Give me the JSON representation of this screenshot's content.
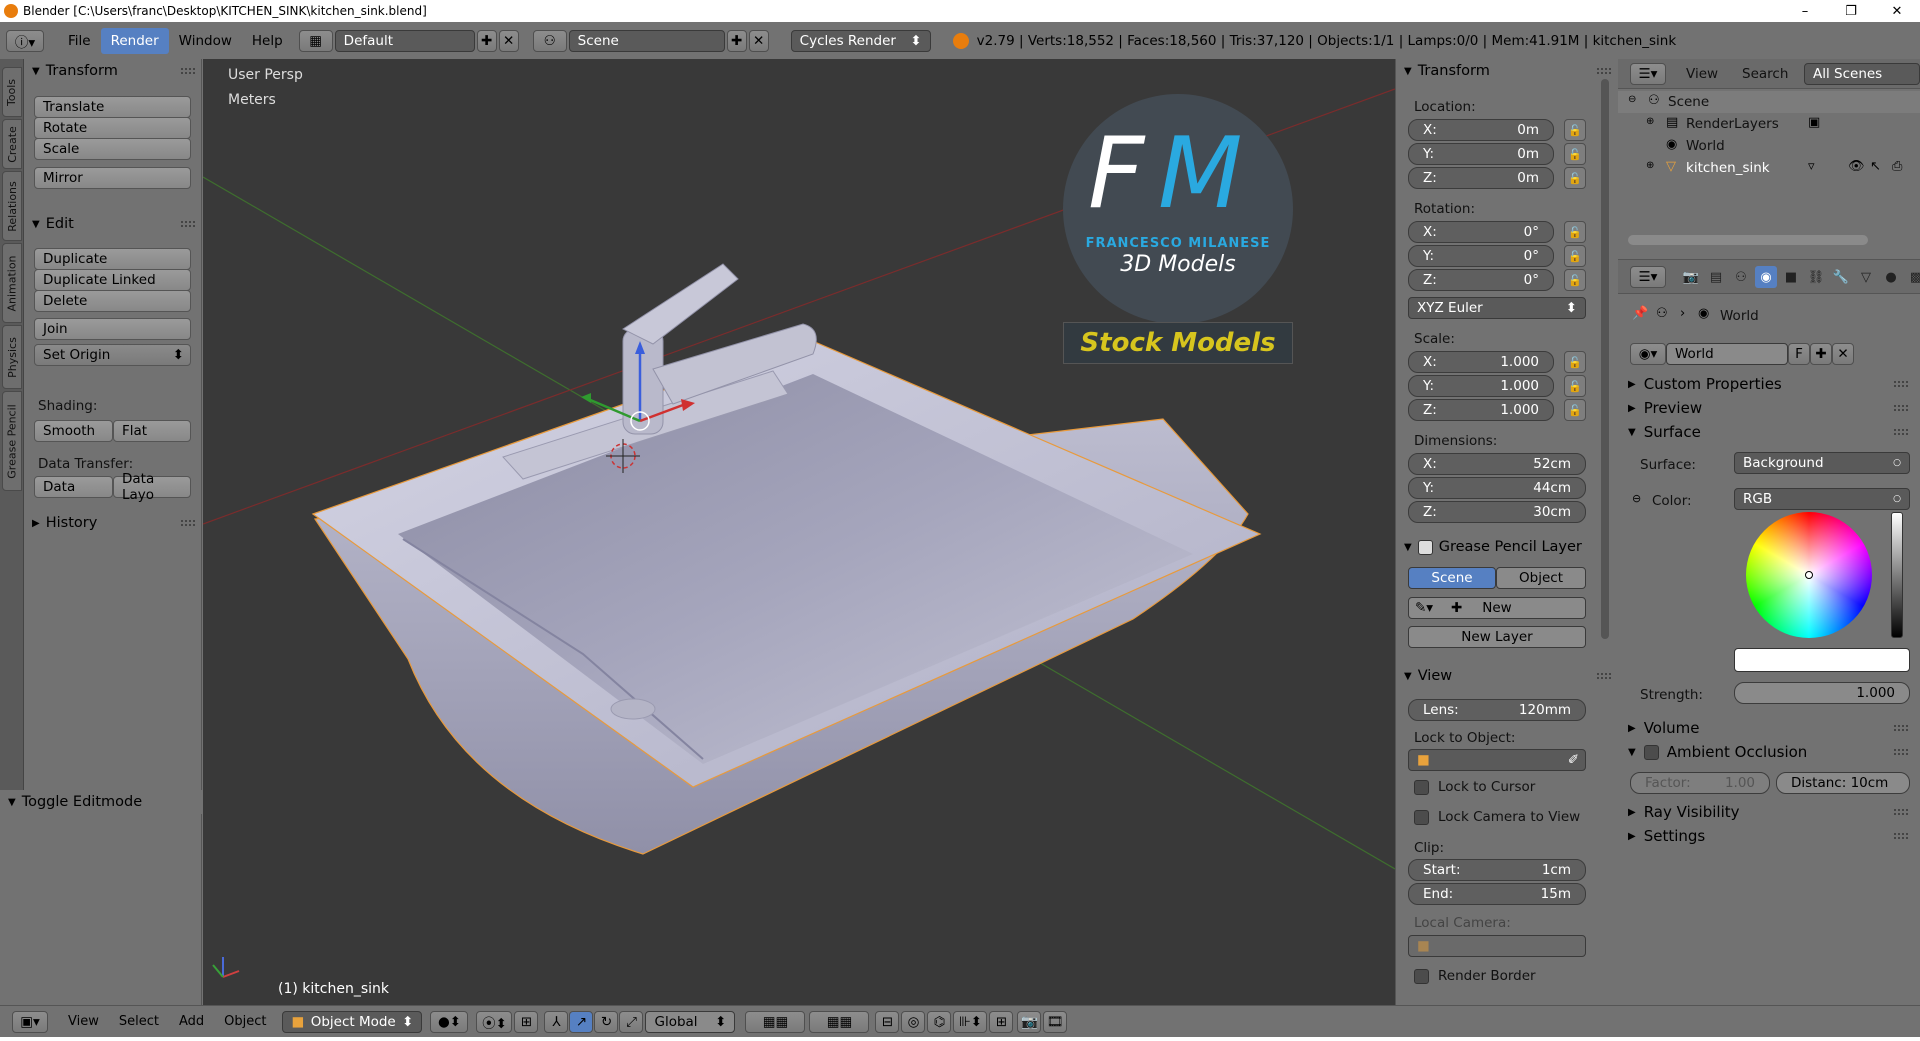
{
  "window": {
    "title": "Blender [C:\\Users\\franc\\Desktop\\KITCHEN_SINK\\kitchen_sink.blend]",
    "minimize": "–",
    "maximize": "❐",
    "close": "✕"
  },
  "infobar": {
    "menus": [
      "File",
      "Render",
      "Window",
      "Help"
    ],
    "active_menu": "Render",
    "screen_layout": "Default",
    "scene": "Scene",
    "engine": "Cycles Render",
    "stats": "v2.79 | Verts:18,552 | Faces:18,560 | Tris:37,120 | Objects:1/1 | Lamps:0/0 | Mem:41.91M | kitchen_sink"
  },
  "left_tabs": [
    "Tools",
    "Create",
    "Relations",
    "Animation",
    "Physics",
    "Grease Pencil"
  ],
  "tool_panel": {
    "transform_header": "Transform",
    "translate": "Translate",
    "rotate": "Rotate",
    "scale": "Scale",
    "mirror": "Mirror",
    "edit_header": "Edit",
    "duplicate": "Duplicate",
    "duplicate_linked": "Duplicate Linked",
    "delete": "Delete",
    "join": "Join",
    "set_origin": "Set Origin",
    "shading_label": "Shading:",
    "smooth": "Smooth",
    "flat": "Flat",
    "data_transfer_label": "Data Transfer:",
    "data": "Data",
    "data_layo": "Data Layo",
    "history_header": "History",
    "toggle_editmode": "Toggle Editmode"
  },
  "viewport": {
    "view_name": "User Persp",
    "units": "Meters",
    "object_label": "(1) kitchen_sink",
    "logo": {
      "initials_f": "F",
      "initials_m": "M",
      "name": "FRANCESCO MILANESE",
      "subtitle": "3D Models",
      "banner": "Stock Models"
    }
  },
  "transform_panel": {
    "header": "Transform",
    "location_label": "Location:",
    "loc_x": "0m",
    "loc_y": "0m",
    "loc_z": "0m",
    "rotation_label": "Rotation:",
    "rot_x": "0°",
    "rot_y": "0°",
    "rot_z": "0°",
    "rotation_mode": "XYZ Euler",
    "scale_label": "Scale:",
    "scale_x": "1.000",
    "scale_y": "1.000",
    "scale_z": "1.000",
    "dimensions_label": "Dimensions:",
    "dim_x": "52cm",
    "dim_y": "44cm",
    "dim_z": "30cm",
    "axis_x": "X:",
    "axis_y": "Y:",
    "axis_z": "Z:"
  },
  "grease_pencil": {
    "header": "Grease Pencil Layer",
    "scene": "Scene",
    "object": "Object",
    "new": "New",
    "new_layer": "New Layer"
  },
  "view_panel": {
    "header": "View",
    "lens_label": "Lens:",
    "lens": "120mm",
    "lock_to_object": "Lock to Object:",
    "lock_to_cursor": "Lock to Cursor",
    "lock_camera": "Lock Camera to View",
    "clip_label": "Clip:",
    "start_label": "Start:",
    "start": "1cm",
    "end_label": "End:",
    "end": "15m",
    "local_camera": "Local Camera:",
    "render_border": "Render Border"
  },
  "outliner": {
    "view": "View",
    "search": "Search",
    "filter": "All Scenes",
    "items": [
      "Scene",
      "RenderLayers",
      "World",
      "kitchen_sink"
    ]
  },
  "properties": {
    "breadcrumb": "World",
    "world_name": "World",
    "fake_user": "F",
    "custom_properties": "Custom Properties",
    "preview": "Preview",
    "surface": "Surface",
    "surface_label": "Surface:",
    "surface_value": "Background",
    "color_label": "Color:",
    "color_mode": "RGB",
    "strength_label": "Strength:",
    "strength": "1.000",
    "volume": "Volume",
    "ambient_occlusion": "Ambient Occlusion",
    "factor_label": "Factor:",
    "factor": "1.00",
    "distance": "Distanc: 10cm",
    "ray_visibility": "Ray Visibility",
    "settings": "Settings"
  },
  "bottombar": {
    "menus": [
      "View",
      "Select",
      "Add",
      "Object"
    ],
    "mode": "Object Mode",
    "orientation": "Global"
  },
  "colors": {
    "panel": "#727272",
    "viewport": "#393939",
    "accent": "#5680c2",
    "selected_outline": "#e89a3c"
  }
}
